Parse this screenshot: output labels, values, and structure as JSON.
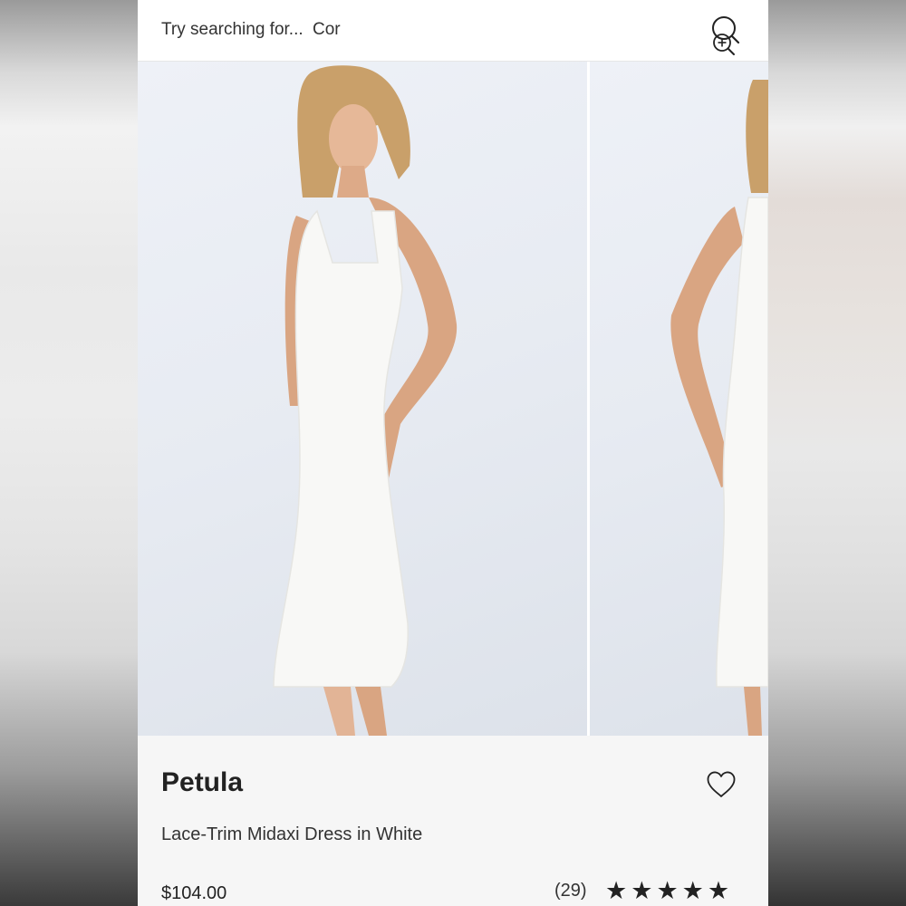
{
  "search": {
    "prefix": "Try searching for...",
    "suggestion": "Cor"
  },
  "icons": {
    "search": "search-icon",
    "zoom": "zoom-in-icon",
    "favorite": "heart-icon",
    "rating": "star-icon"
  },
  "product": {
    "brand": "Petula",
    "name": "Lace-Trim Midaxi Dress in White",
    "price": "$104.00",
    "review_count": "(29)",
    "rating": 5,
    "rating_max": 5
  },
  "colors": {
    "text": "#222222",
    "background": "#ffffff",
    "info_background": "#f6f6f6"
  }
}
